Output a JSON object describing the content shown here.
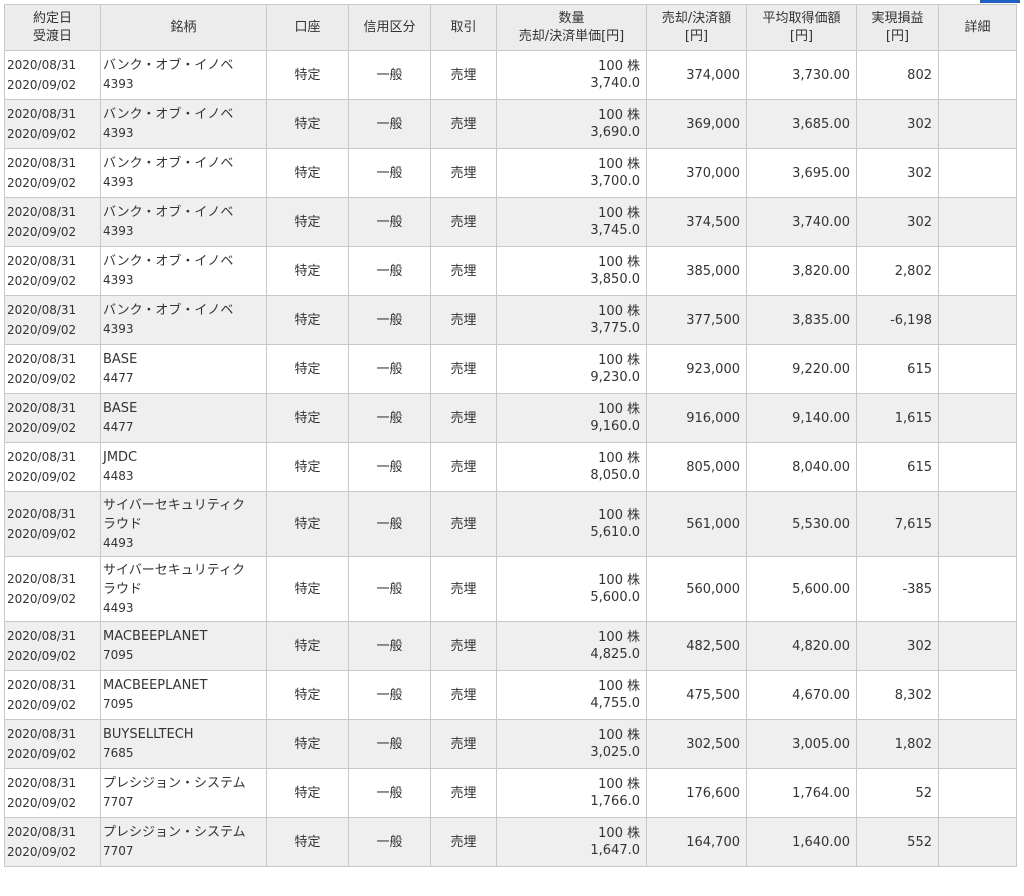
{
  "headers": {
    "date": [
      "約定日",
      "受渡日"
    ],
    "stock": "銘柄",
    "account": "口座",
    "margin_type": "信用区分",
    "trade": "取引",
    "quantity": [
      "数量",
      "売却/決済単価[円]"
    ],
    "amount": [
      "売却/決済額",
      "[円]"
    ],
    "avg_cost": [
      "平均取得価額",
      "[円]"
    ],
    "pl": [
      "実現損益",
      "[円]"
    ],
    "detail": "詳細"
  },
  "colors": {
    "stripe": "#efefef",
    "header_bg": "#ececec",
    "border": "#c8c8c8",
    "accent": "#1f5fbf"
  },
  "rows": [
    {
      "trade_date": "2020/08/31",
      "settle_date": "2020/09/02",
      "name_lines": [
        "バンク・オブ・イノベ"
      ],
      "code": "4393",
      "account": "特定",
      "margin": "一般",
      "trade": "売埋",
      "qty": "100",
      "unit": "株",
      "price": "3,740.0",
      "amount": "374,000",
      "avg": "3,730.00",
      "pl": "802",
      "detail": ""
    },
    {
      "trade_date": "2020/08/31",
      "settle_date": "2020/09/02",
      "name_lines": [
        "バンク・オブ・イノベ"
      ],
      "code": "4393",
      "account": "特定",
      "margin": "一般",
      "trade": "売埋",
      "qty": "100",
      "unit": "株",
      "price": "3,690.0",
      "amount": "369,000",
      "avg": "3,685.00",
      "pl": "302",
      "detail": ""
    },
    {
      "trade_date": "2020/08/31",
      "settle_date": "2020/09/02",
      "name_lines": [
        "バンク・オブ・イノベ"
      ],
      "code": "4393",
      "account": "特定",
      "margin": "一般",
      "trade": "売埋",
      "qty": "100",
      "unit": "株",
      "price": "3,700.0",
      "amount": "370,000",
      "avg": "3,695.00",
      "pl": "302",
      "detail": ""
    },
    {
      "trade_date": "2020/08/31",
      "settle_date": "2020/09/02",
      "name_lines": [
        "バンク・オブ・イノベ"
      ],
      "code": "4393",
      "account": "特定",
      "margin": "一般",
      "trade": "売埋",
      "qty": "100",
      "unit": "株",
      "price": "3,745.0",
      "amount": "374,500",
      "avg": "3,740.00",
      "pl": "302",
      "detail": ""
    },
    {
      "trade_date": "2020/08/31",
      "settle_date": "2020/09/02",
      "name_lines": [
        "バンク・オブ・イノベ"
      ],
      "code": "4393",
      "account": "特定",
      "margin": "一般",
      "trade": "売埋",
      "qty": "100",
      "unit": "株",
      "price": "3,850.0",
      "amount": "385,000",
      "avg": "3,820.00",
      "pl": "2,802",
      "detail": ""
    },
    {
      "trade_date": "2020/08/31",
      "settle_date": "2020/09/02",
      "name_lines": [
        "バンク・オブ・イノベ"
      ],
      "code": "4393",
      "account": "特定",
      "margin": "一般",
      "trade": "売埋",
      "qty": "100",
      "unit": "株",
      "price": "3,775.0",
      "amount": "377,500",
      "avg": "3,835.00",
      "pl": "-6,198",
      "detail": ""
    },
    {
      "trade_date": "2020/08/31",
      "settle_date": "2020/09/02",
      "name_lines": [
        "BASE"
      ],
      "code": "4477",
      "account": "特定",
      "margin": "一般",
      "trade": "売埋",
      "qty": "100",
      "unit": "株",
      "price": "9,230.0",
      "amount": "923,000",
      "avg": "9,220.00",
      "pl": "615",
      "detail": ""
    },
    {
      "trade_date": "2020/08/31",
      "settle_date": "2020/09/02",
      "name_lines": [
        "BASE"
      ],
      "code": "4477",
      "account": "特定",
      "margin": "一般",
      "trade": "売埋",
      "qty": "100",
      "unit": "株",
      "price": "9,160.0",
      "amount": "916,000",
      "avg": "9,140.00",
      "pl": "1,615",
      "detail": ""
    },
    {
      "trade_date": "2020/08/31",
      "settle_date": "2020/09/02",
      "name_lines": [
        "JMDC"
      ],
      "code": "4483",
      "account": "特定",
      "margin": "一般",
      "trade": "売埋",
      "qty": "100",
      "unit": "株",
      "price": "8,050.0",
      "amount": "805,000",
      "avg": "8,040.00",
      "pl": "615",
      "detail": ""
    },
    {
      "trade_date": "2020/08/31",
      "settle_date": "2020/09/02",
      "name_lines": [
        "サイバーセキュリティク",
        "ラウド"
      ],
      "code": "4493",
      "account": "特定",
      "margin": "一般",
      "trade": "売埋",
      "qty": "100",
      "unit": "株",
      "price": "5,610.0",
      "amount": "561,000",
      "avg": "5,530.00",
      "pl": "7,615",
      "detail": ""
    },
    {
      "trade_date": "2020/08/31",
      "settle_date": "2020/09/02",
      "name_lines": [
        "サイバーセキュリティク",
        "ラウド"
      ],
      "code": "4493",
      "account": "特定",
      "margin": "一般",
      "trade": "売埋",
      "qty": "100",
      "unit": "株",
      "price": "5,600.0",
      "amount": "560,000",
      "avg": "5,600.00",
      "pl": "-385",
      "detail": ""
    },
    {
      "trade_date": "2020/08/31",
      "settle_date": "2020/09/02",
      "name_lines": [
        "MACBEEPLANET"
      ],
      "code": "7095",
      "account": "特定",
      "margin": "一般",
      "trade": "売埋",
      "qty": "100",
      "unit": "株",
      "price": "4,825.0",
      "amount": "482,500",
      "avg": "4,820.00",
      "pl": "302",
      "detail": ""
    },
    {
      "trade_date": "2020/08/31",
      "settle_date": "2020/09/02",
      "name_lines": [
        "MACBEEPLANET"
      ],
      "code": "7095",
      "account": "特定",
      "margin": "一般",
      "trade": "売埋",
      "qty": "100",
      "unit": "株",
      "price": "4,755.0",
      "amount": "475,500",
      "avg": "4,670.00",
      "pl": "8,302",
      "detail": ""
    },
    {
      "trade_date": "2020/08/31",
      "settle_date": "2020/09/02",
      "name_lines": [
        "BUYSELLTECH"
      ],
      "code": "7685",
      "account": "特定",
      "margin": "一般",
      "trade": "売埋",
      "qty": "100",
      "unit": "株",
      "price": "3,025.0",
      "amount": "302,500",
      "avg": "3,005.00",
      "pl": "1,802",
      "detail": ""
    },
    {
      "trade_date": "2020/08/31",
      "settle_date": "2020/09/02",
      "name_lines": [
        "プレシジョン・システム"
      ],
      "code": "7707",
      "account": "特定",
      "margin": "一般",
      "trade": "売埋",
      "qty": "100",
      "unit": "株",
      "price": "1,766.0",
      "amount": "176,600",
      "avg": "1,764.00",
      "pl": "52",
      "detail": ""
    },
    {
      "trade_date": "2020/08/31",
      "settle_date": "2020/09/02",
      "name_lines": [
        "プレシジョン・システム"
      ],
      "code": "7707",
      "account": "特定",
      "margin": "一般",
      "trade": "売埋",
      "qty": "100",
      "unit": "株",
      "price": "1,647.0",
      "amount": "164,700",
      "avg": "1,640.00",
      "pl": "552",
      "detail": ""
    }
  ]
}
